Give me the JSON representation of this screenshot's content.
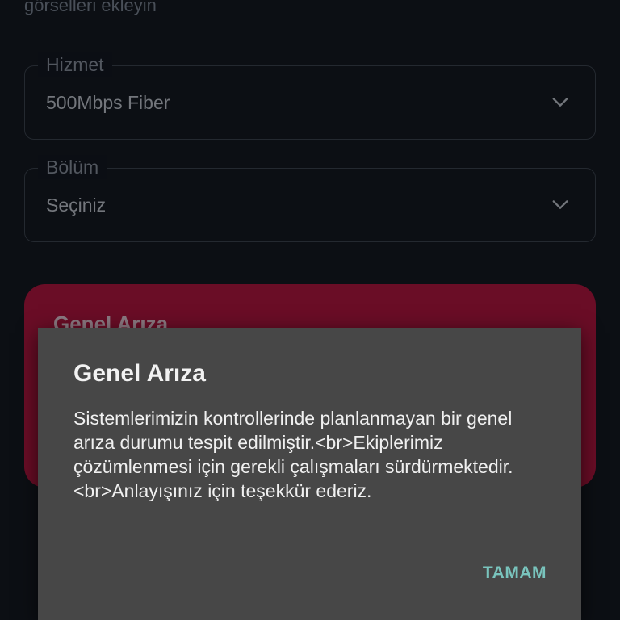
{
  "form": {
    "top_text": "görselleri ekleyin",
    "service": {
      "label": "Hizmet",
      "value": "500Mbps Fiber"
    },
    "section": {
      "label": "Bölüm",
      "value": "Seçiniz"
    }
  },
  "alert_card": {
    "title": "Genel Arıza",
    "color": "#b80d36"
  },
  "dialog": {
    "title": "Genel Arıza",
    "message": "Sistemlerimizin kontrollerinde planlanmayan bir genel arıza durumu tespit edilmiştir.<br>Ekiplerimiz çözümlenmesi için gerekli çalışmaları sürdürmektedir.<br>Anlayışınız için teşekkür ederiz.",
    "ok_label": "TAMAM",
    "ok_color": "#79c4bd"
  },
  "icons": {
    "dropdown": "chevron-down-icon"
  }
}
